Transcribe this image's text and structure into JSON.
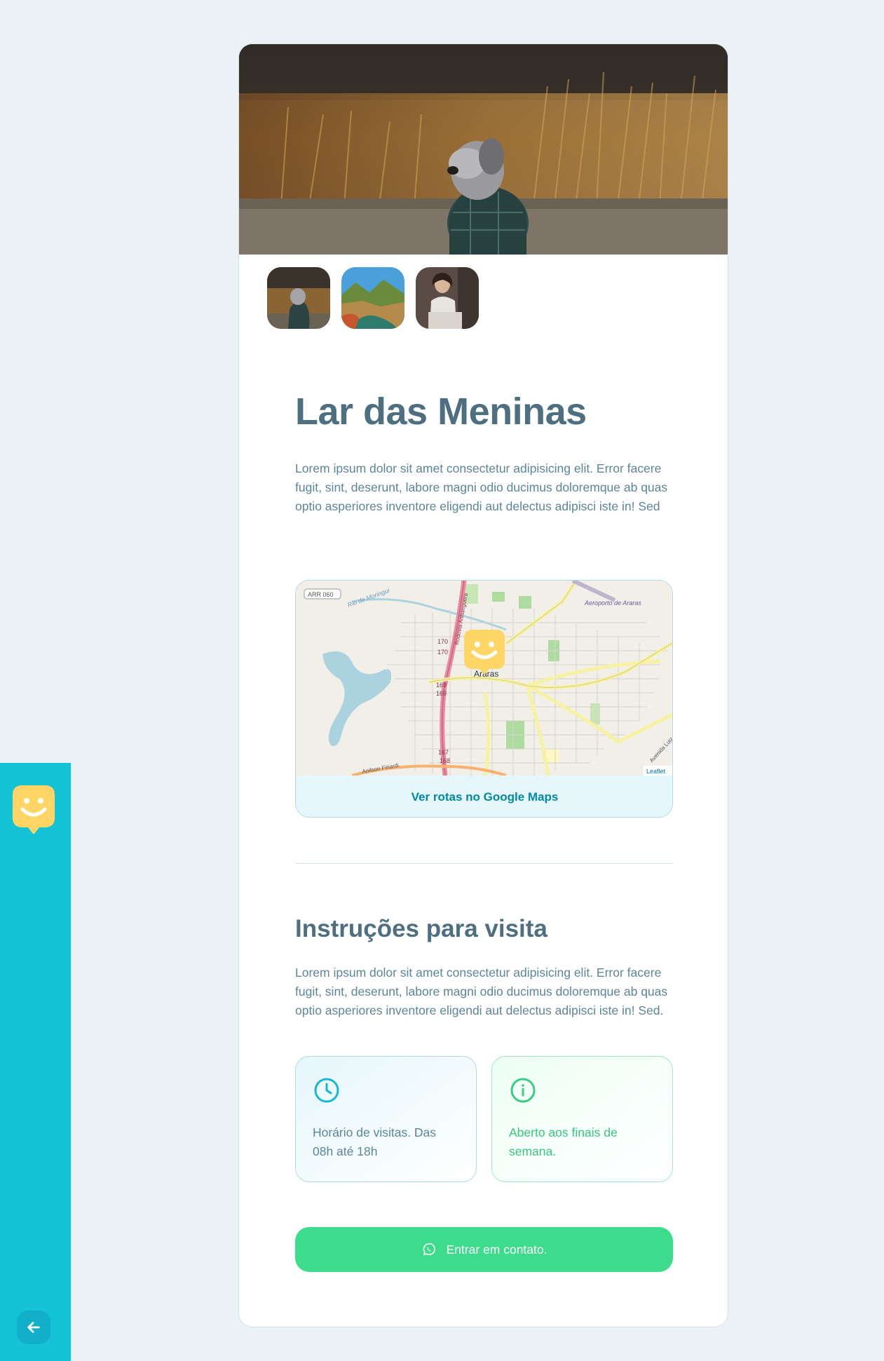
{
  "sidebar": {
    "logo_icon": "happy-face-pin-icon",
    "back_icon": "arrow-left-icon",
    "color": "#15c3d6"
  },
  "orphanage": {
    "name": "Lar das Meninas",
    "about": "Lorem ipsum dolor sit amet consectetur adipisicing elit. Error facere fugit, sint, deserunt, labore magni odio ducimus doloremque ab quas optio asperiores inventore eligendi aut delectus adipisci iste in! Sed",
    "images": [
      "dog-in-grass-photo",
      "river-landscape-photo",
      "woman-sitting-photo"
    ]
  },
  "map": {
    "labels": {
      "road_code": "ARR 060",
      "river": "Rio do Moringui",
      "avenue": "Rodovia Anhanguera",
      "airport": "Aeroporto de Araras",
      "city": "Araras",
      "km_170a": "170",
      "km_170b": "170",
      "km_169a": "169",
      "km_169b": "169",
      "km_167": "167",
      "km_168": "168",
      "avenue_right": "Avenida Luiz Carl",
      "road_bottom": "Anilson Finardi",
      "attribution": "Leaflet"
    },
    "route_link": "Ver rotas no Google Maps",
    "marker_icon": "happy-face-pin-icon"
  },
  "instructions": {
    "title": "Instruções para visita",
    "text": "Lorem ipsum dolor sit amet consectetur adipisicing elit. Error facere fugit, sint, deserunt, labore magni odio ducimus doloremque ab quas optio asperiores inventore eligendi aut delectus adipisci iste in! Sed."
  },
  "info": {
    "hours": {
      "icon": "clock-icon",
      "text": "Horário de visitas. Das 08h até 18h"
    },
    "open": {
      "icon": "info-icon",
      "text": "Aberto aos finais de semana."
    }
  },
  "contact": {
    "label": "Entrar em contato.",
    "icon": "whatsapp-icon",
    "color": "#3cdc8c"
  }
}
